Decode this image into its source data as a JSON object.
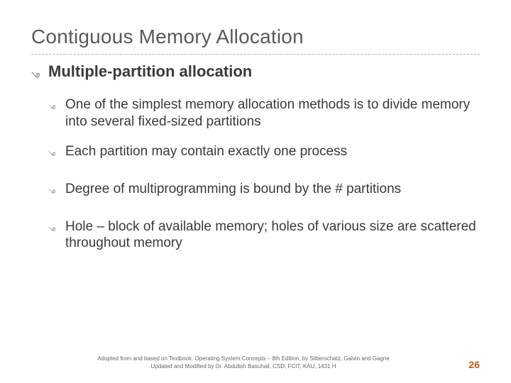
{
  "title": "Contiguous Memory Allocation",
  "subtitle": "Multiple-partition allocation",
  "bullets": [
    "One of the simplest memory allocation methods is to divide memory into several fixed-sized partitions",
    "Each partition may contain exactly one process",
    "Degree of multiprogramming is bound by the # partitions",
    "Hole – block of available memory; holes of various size are scattered throughout memory"
  ],
  "footer": {
    "line1": "Adopted from and based on Textbook: Operating System Concepts – 8th Edition, by Silberschatz, Galvin and Gagne",
    "line2": "Updated and Modified by Dr. Abdullah Basuhail, CSD, FCIT, KAU, 1431 H"
  },
  "page_number": "26",
  "bullet_glyph": "࿓"
}
